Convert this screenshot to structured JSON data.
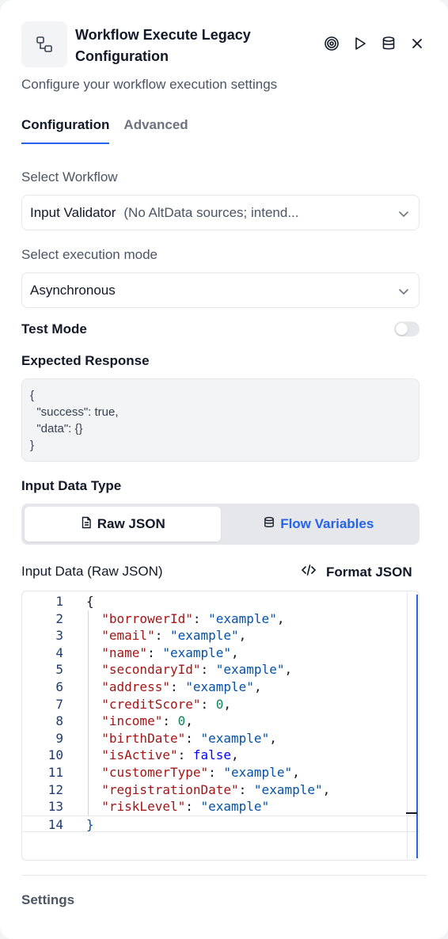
{
  "header": {
    "title": "Workflow Execute Legacy Configuration",
    "subtitle": "Configure your workflow execution settings"
  },
  "tabs": [
    {
      "label": "Configuration",
      "active": true
    },
    {
      "label": "Advanced",
      "active": false
    }
  ],
  "workflow": {
    "label": "Select Workflow",
    "value_name": "Input Validator",
    "value_desc": "(No AltData sources; intend..."
  },
  "execution_mode": {
    "label": "Select execution mode",
    "value": "Asynchronous"
  },
  "test_mode": {
    "label": "Test Mode",
    "enabled": false
  },
  "expected_response": {
    "label": "Expected Response",
    "value": "{\n  \"success\": true,\n  \"data\": {}\n}"
  },
  "input_type": {
    "label": "Input Data Type",
    "options": [
      {
        "label": "Raw JSON",
        "icon": "document-icon",
        "active": true
      },
      {
        "label": "Flow Variables",
        "icon": "database-icon",
        "active": false
      }
    ]
  },
  "input_data": {
    "label": "Input Data (Raw JSON)",
    "format_label": "Format JSON",
    "line_numbers": [
      "1",
      "2",
      "3",
      "4",
      "5",
      "6",
      "7",
      "8",
      "9",
      "10",
      "11",
      "12",
      "13",
      "14"
    ],
    "lines": [
      [
        [
          "p",
          "{"
        ]
      ],
      [
        [
          "p",
          "  "
        ],
        [
          "k",
          "\"borrowerId\""
        ],
        [
          "p",
          ": "
        ],
        [
          "s",
          "\"example\""
        ],
        [
          "p",
          ","
        ]
      ],
      [
        [
          "p",
          "  "
        ],
        [
          "k",
          "\"email\""
        ],
        [
          "p",
          ": "
        ],
        [
          "s",
          "\"example\""
        ],
        [
          "p",
          ","
        ]
      ],
      [
        [
          "p",
          "  "
        ],
        [
          "k",
          "\"name\""
        ],
        [
          "p",
          ": "
        ],
        [
          "s",
          "\"example\""
        ],
        [
          "p",
          ","
        ]
      ],
      [
        [
          "p",
          "  "
        ],
        [
          "k",
          "\"secondaryId\""
        ],
        [
          "p",
          ": "
        ],
        [
          "s",
          "\"example\""
        ],
        [
          "p",
          ","
        ]
      ],
      [
        [
          "p",
          "  "
        ],
        [
          "k",
          "\"address\""
        ],
        [
          "p",
          ": "
        ],
        [
          "s",
          "\"example\""
        ],
        [
          "p",
          ","
        ]
      ],
      [
        [
          "p",
          "  "
        ],
        [
          "k",
          "\"creditScore\""
        ],
        [
          "p",
          ": "
        ],
        [
          "n",
          "0"
        ],
        [
          "p",
          ","
        ]
      ],
      [
        [
          "p",
          "  "
        ],
        [
          "k",
          "\"income\""
        ],
        [
          "p",
          ": "
        ],
        [
          "n",
          "0"
        ],
        [
          "p",
          ","
        ]
      ],
      [
        [
          "p",
          "  "
        ],
        [
          "k",
          "\"birthDate\""
        ],
        [
          "p",
          ": "
        ],
        [
          "s",
          "\"example\""
        ],
        [
          "p",
          ","
        ]
      ],
      [
        [
          "p",
          "  "
        ],
        [
          "k",
          "\"isActive\""
        ],
        [
          "p",
          ": "
        ],
        [
          "b",
          "false"
        ],
        [
          "p",
          ","
        ]
      ],
      [
        [
          "p",
          "  "
        ],
        [
          "k",
          "\"customerType\""
        ],
        [
          "p",
          ": "
        ],
        [
          "s",
          "\"example\""
        ],
        [
          "p",
          ","
        ]
      ],
      [
        [
          "p",
          "  "
        ],
        [
          "k",
          "\"registrationDate\""
        ],
        [
          "p",
          ": "
        ],
        [
          "s",
          "\"example\""
        ],
        [
          "p",
          ","
        ]
      ],
      [
        [
          "p",
          "  "
        ],
        [
          "k",
          "\"riskLevel\""
        ],
        [
          "p",
          ": "
        ],
        [
          "s",
          "\"example\""
        ]
      ],
      [
        [
          "s",
          "}"
        ]
      ]
    ]
  },
  "footer": {
    "settings_label": "Settings"
  },
  "colors": {
    "accent": "#2563eb"
  }
}
